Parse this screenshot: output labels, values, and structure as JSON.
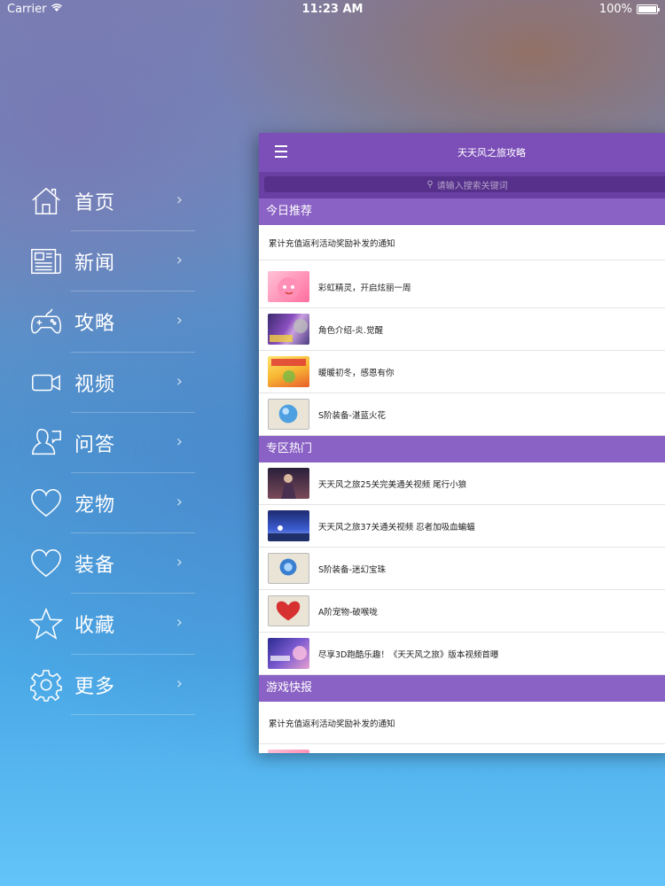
{
  "status": {
    "carrier": "Carrier",
    "time": "11:23 AM",
    "battery": "100%"
  },
  "menu": [
    {
      "label": "首页",
      "icon": "home-icon"
    },
    {
      "label": "新闻",
      "icon": "newspaper-icon"
    },
    {
      "label": "攻略",
      "icon": "gamepad-icon"
    },
    {
      "label": "视频",
      "icon": "video-camera-icon"
    },
    {
      "label": "问答",
      "icon": "qa-person-icon"
    },
    {
      "label": "宠物",
      "icon": "heart-icon"
    },
    {
      "label": "装备",
      "icon": "heart-outline-icon"
    },
    {
      "label": "收藏",
      "icon": "star-icon"
    },
    {
      "label": "更多",
      "icon": "gear-icon"
    }
  ],
  "panel": {
    "title": "天天风之旅攻略",
    "search_placeholder": "请输入搜索关键词",
    "sections": [
      {
        "header": "今日推荐",
        "text_item": "累计充值返利活动奖励补发的通知",
        "items": [
          {
            "text": "彩虹精灵，开启炫丽一周",
            "thumb": "pink-creature"
          },
          {
            "text": "角色介绍-炎.觉醒",
            "thumb": "character-purple"
          },
          {
            "text": "暖暖初冬，感恩有你",
            "thumb": "winter-yellow"
          },
          {
            "text": "S阶装备-湛蓝火花",
            "thumb": "blue-gem"
          }
        ]
      },
      {
        "header": "专区热门",
        "items": [
          {
            "text": "天天风之旅25关完美通关视频 尾行小狼",
            "thumb": "dark-figure"
          },
          {
            "text": "天天风之旅37关通关视频 忍者加吸血蝙蝠",
            "thumb": "blue-stage"
          },
          {
            "text": "S阶装备-迷幻宝珠",
            "thumb": "blue-orb"
          },
          {
            "text": "A阶宠物-破喉咙",
            "thumb": "red-heart"
          },
          {
            "text": "尽享3D跑酷乐趣！《天天风之旅》版本视频首曝",
            "thumb": "purple-banner"
          }
        ]
      },
      {
        "header": "游戏快报",
        "text_item": "累计充值返利活动奖励补发的通知",
        "items": [
          {
            "text": "",
            "thumb": "pink-partial"
          }
        ]
      }
    ]
  },
  "colors": {
    "nav": "#7c4fb8",
    "section": "#8a61c4",
    "search": "#6a3fa3"
  }
}
